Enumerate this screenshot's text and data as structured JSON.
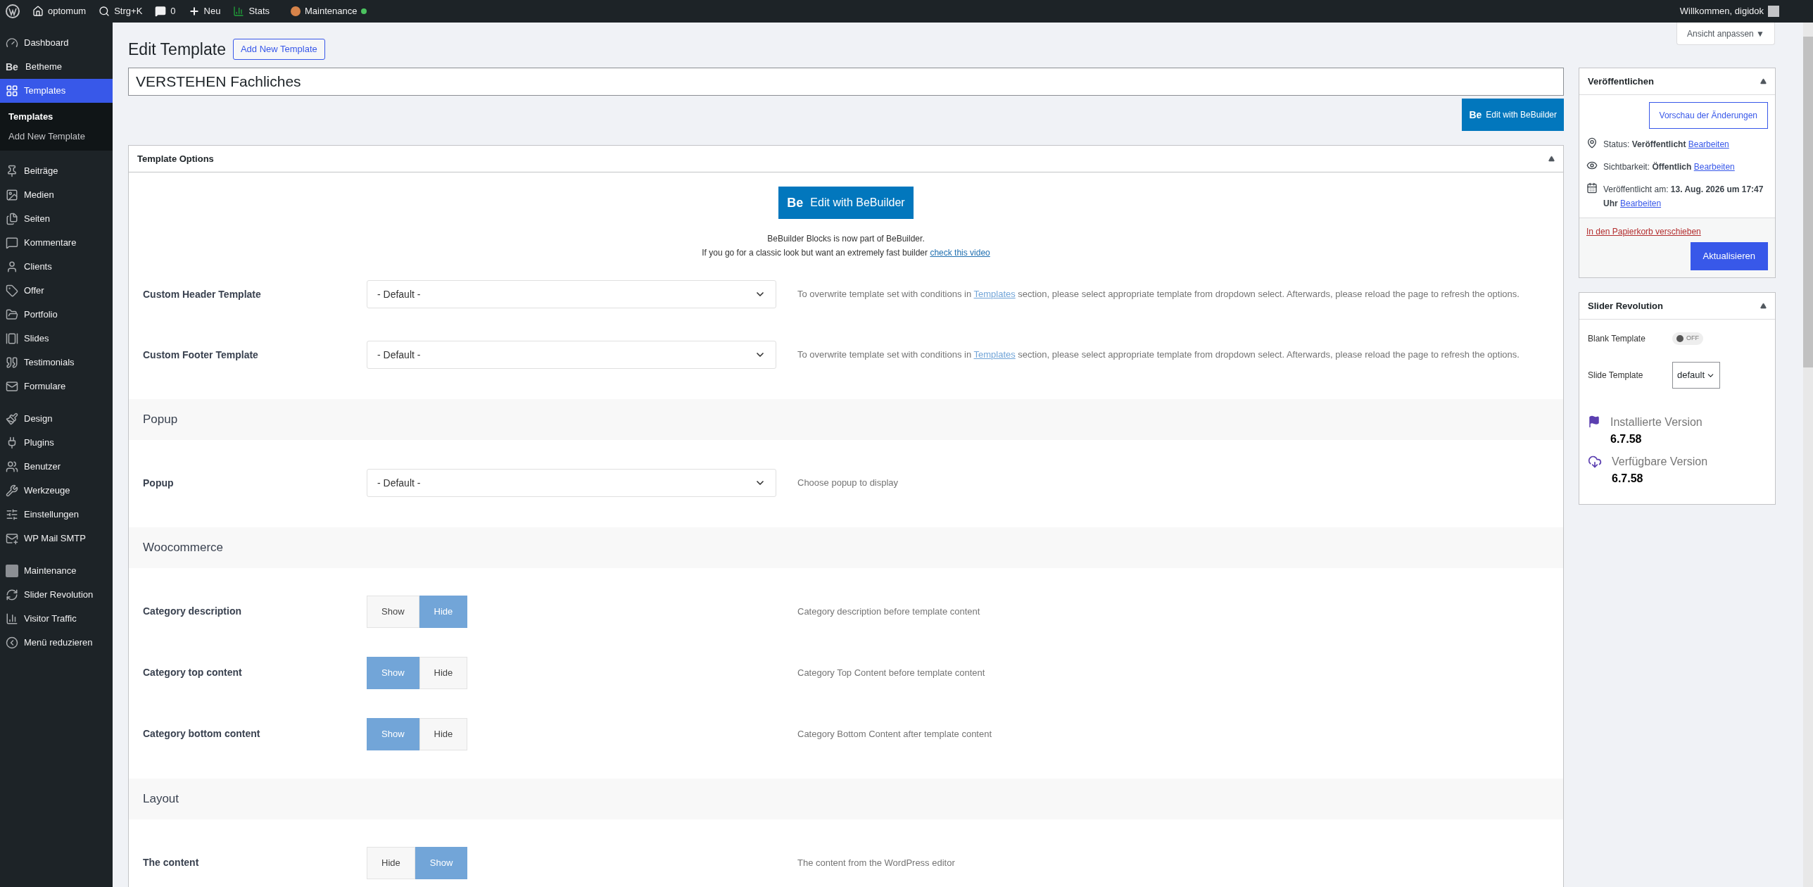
{
  "top_bar": {
    "site": "optomum",
    "search": "Strg+K",
    "comments": "0",
    "new": "Neu",
    "stats": "Stats",
    "maintenance": "Maintenance",
    "greeting": "Willkommen, digidok"
  },
  "sidebar": {
    "groups": [
      [
        {
          "label": "Dashboard",
          "selected": false
        },
        {
          "label": "Betheme",
          "selected": false,
          "badge": "Be"
        },
        {
          "label": "Templates",
          "selected": true,
          "children": [
            {
              "label": "Templates",
              "selected": true
            },
            {
              "label": "Add New Template",
              "selected": false
            }
          ]
        }
      ],
      [
        {
          "label": "Beiträge",
          "selected": false
        },
        {
          "label": "Medien",
          "selected": false
        },
        {
          "label": "Seiten",
          "selected": false
        },
        {
          "label": "Kommentare",
          "selected": false
        },
        {
          "label": "Clients",
          "selected": false
        },
        {
          "label": "Offer",
          "selected": false
        },
        {
          "label": "Portfolio",
          "selected": false
        },
        {
          "label": "Slides",
          "selected": false
        },
        {
          "label": "Testimonials",
          "selected": false
        },
        {
          "label": "Formulare",
          "selected": false
        }
      ],
      [
        {
          "label": "Design",
          "selected": false
        },
        {
          "label": "Plugins",
          "selected": false
        },
        {
          "label": "Benutzer",
          "selected": false
        },
        {
          "label": "Werkzeuge",
          "selected": false
        },
        {
          "label": "Einstellungen",
          "selected": false
        },
        {
          "label": "WP Mail SMTP",
          "selected": false
        }
      ],
      [
        {
          "label": "Maintenance",
          "selected": false
        },
        {
          "label": "Slider Revolution",
          "selected": false
        },
        {
          "label": "Visitor Traffic",
          "selected": false
        },
        {
          "label": "Menü reduzieren",
          "selected": false
        }
      ]
    ]
  },
  "screen_options": "Ansicht anpassen ▼",
  "page": {
    "title": "Edit Template",
    "add_new": "Add New Template",
    "template_title": "VERSTEHEN Fachliches",
    "builder_badge": "Be",
    "builder_button": "Edit with BeBuilder"
  },
  "template_options": {
    "title": "Template Options",
    "builder_badge": "Be",
    "builder_button": "Edit with BeBuilder",
    "note_line_1": "BeBuilder Blocks is now part of BeBuilder.",
    "note_line_2": "If you go for a classic look but want an extremely fast builder",
    "note_link": "check this video",
    "sections": [
      {
        "kind": "select",
        "label": "Custom Header Template",
        "value": "- Default -",
        "description": {
          "before": "To overwrite template set with conditions in ",
          "link": "Templates",
          "after": " section, please select appropriate template from dropdown select. Afterwards, please reload the page to refresh the options."
        }
      },
      {
        "kind": "select",
        "label": "Custom Footer Template",
        "value": "- Default -",
        "description": {
          "before": "To overwrite template set with conditions in ",
          "link": "Templates",
          "after": " section, please select appropriate template from dropdown select. Afterwards, please reload the page to refresh the options."
        }
      },
      {
        "kind": "heading",
        "label": "Popup"
      },
      {
        "kind": "select",
        "label": "Popup",
        "value": "- Default -",
        "description": {
          "before": "Choose popup to display"
        }
      },
      {
        "kind": "heading",
        "label": "Woocommerce"
      },
      {
        "kind": "toggle",
        "label": "Category description",
        "options": [
          {
            "label": "Show",
            "selected": false
          },
          {
            "label": "Hide",
            "selected": true
          }
        ],
        "description": {
          "before": "Category description before template content"
        }
      },
      {
        "kind": "toggle",
        "label": "Category top content",
        "options": [
          {
            "label": "Show",
            "selected": true
          },
          {
            "label": "Hide",
            "selected": false
          }
        ],
        "description": {
          "before": "Category Top Content before template content"
        }
      },
      {
        "kind": "toggle",
        "label": "Category bottom content",
        "options": [
          {
            "label": "Show",
            "selected": true
          },
          {
            "label": "Hide",
            "selected": false
          }
        ],
        "description": {
          "before": "Category Bottom Content after template content"
        }
      },
      {
        "kind": "heading",
        "label": "Layout"
      },
      {
        "kind": "toggle",
        "label": "The content",
        "options": [
          {
            "label": "Hide",
            "selected": false
          },
          {
            "label": "Show",
            "selected": true
          }
        ],
        "description": {
          "before": "The content from the WordPress editor"
        }
      }
    ]
  },
  "publish": {
    "title": "Veröffentlichen",
    "preview": "Vorschau der Änderungen",
    "status_label": "Status:",
    "status_value": "Veröffentlicht",
    "status_edit": "Bearbeiten",
    "visibility_label": "Sichtbarkeit:",
    "visibility_value": "Öffentlich",
    "visibility_edit": "Bearbeiten",
    "date_label": "Veröffentlicht am:",
    "date_value": "13. Aug. 2026 um 17:47 Uhr",
    "date_edit": "Bearbeiten",
    "trash": "In den Papierkorb verschieben",
    "update": "Aktualisieren"
  },
  "slider_revolution": {
    "title": "Slider Revolution",
    "blank_label": "Blank Template",
    "blank_on": false,
    "blank_state": "OFF",
    "slide_label": "Slide Template",
    "slide_value": "default",
    "installed_label": "Installierte Version",
    "installed_value": "6.7.58",
    "available_label": "Verfügbare Version",
    "available_value": "6.7.58"
  }
}
